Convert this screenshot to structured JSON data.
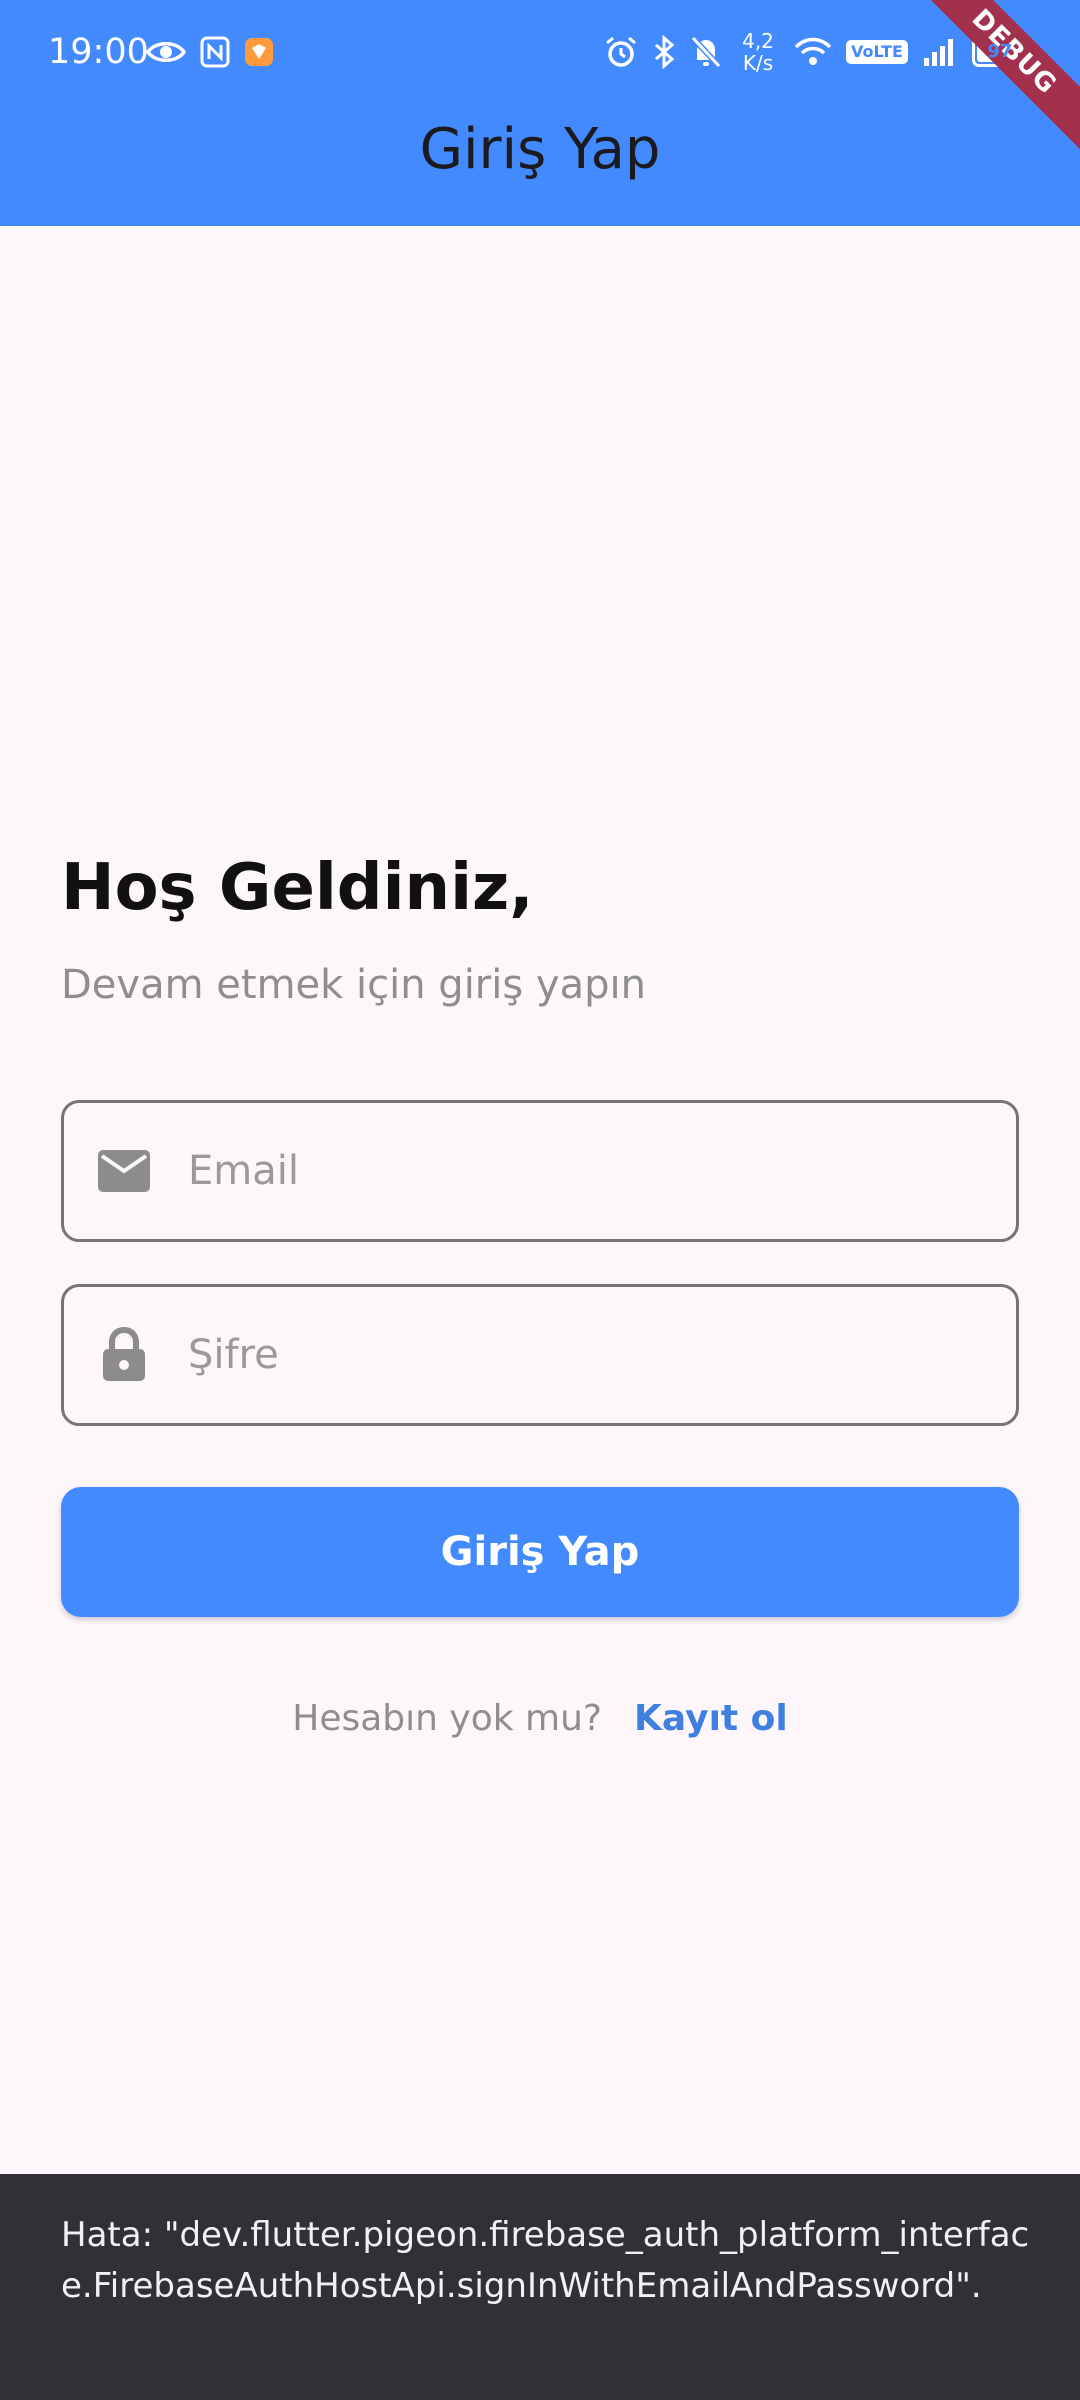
{
  "status_bar": {
    "time": "19:00",
    "net_speed_value": "4,2",
    "net_speed_unit": "K/s",
    "volte_label": "VoLTE",
    "battery_level": "97",
    "left_icons": [
      "eye-icon",
      "nfc-icon",
      "shield-badge-icon"
    ],
    "right_icons": [
      "alarm-icon",
      "bluetooth-icon",
      "bell-off-icon",
      "wifi-icon",
      "signal-icon",
      "battery-icon"
    ]
  },
  "app_bar": {
    "title": "Giriş Yap",
    "debug_banner": "DEBUG"
  },
  "login": {
    "welcome_title": "Hoş Geldiniz,",
    "welcome_subtitle": "Devam etmek için giriş yapın",
    "email_placeholder": "Email",
    "email_icon": "mail-icon",
    "password_placeholder": "Şifre",
    "password_icon": "lock-icon",
    "login_button": "Giriş Yap",
    "no_account_text": "Hesabın yok mu?",
    "signup_link": "Kayıt ol"
  },
  "snackbar": {
    "message": "Hata: \"dev.flutter.pigeon.firebase_auth_platform_interface.FirebaseAuthHostApi.signInWithEmailAndPassword\"."
  },
  "colors": {
    "primary": "#448aff",
    "background": "#fdf7fb",
    "snackbar_bg": "#313034",
    "link": "#3f7fe0",
    "debug_ribbon": "#a3304d"
  }
}
